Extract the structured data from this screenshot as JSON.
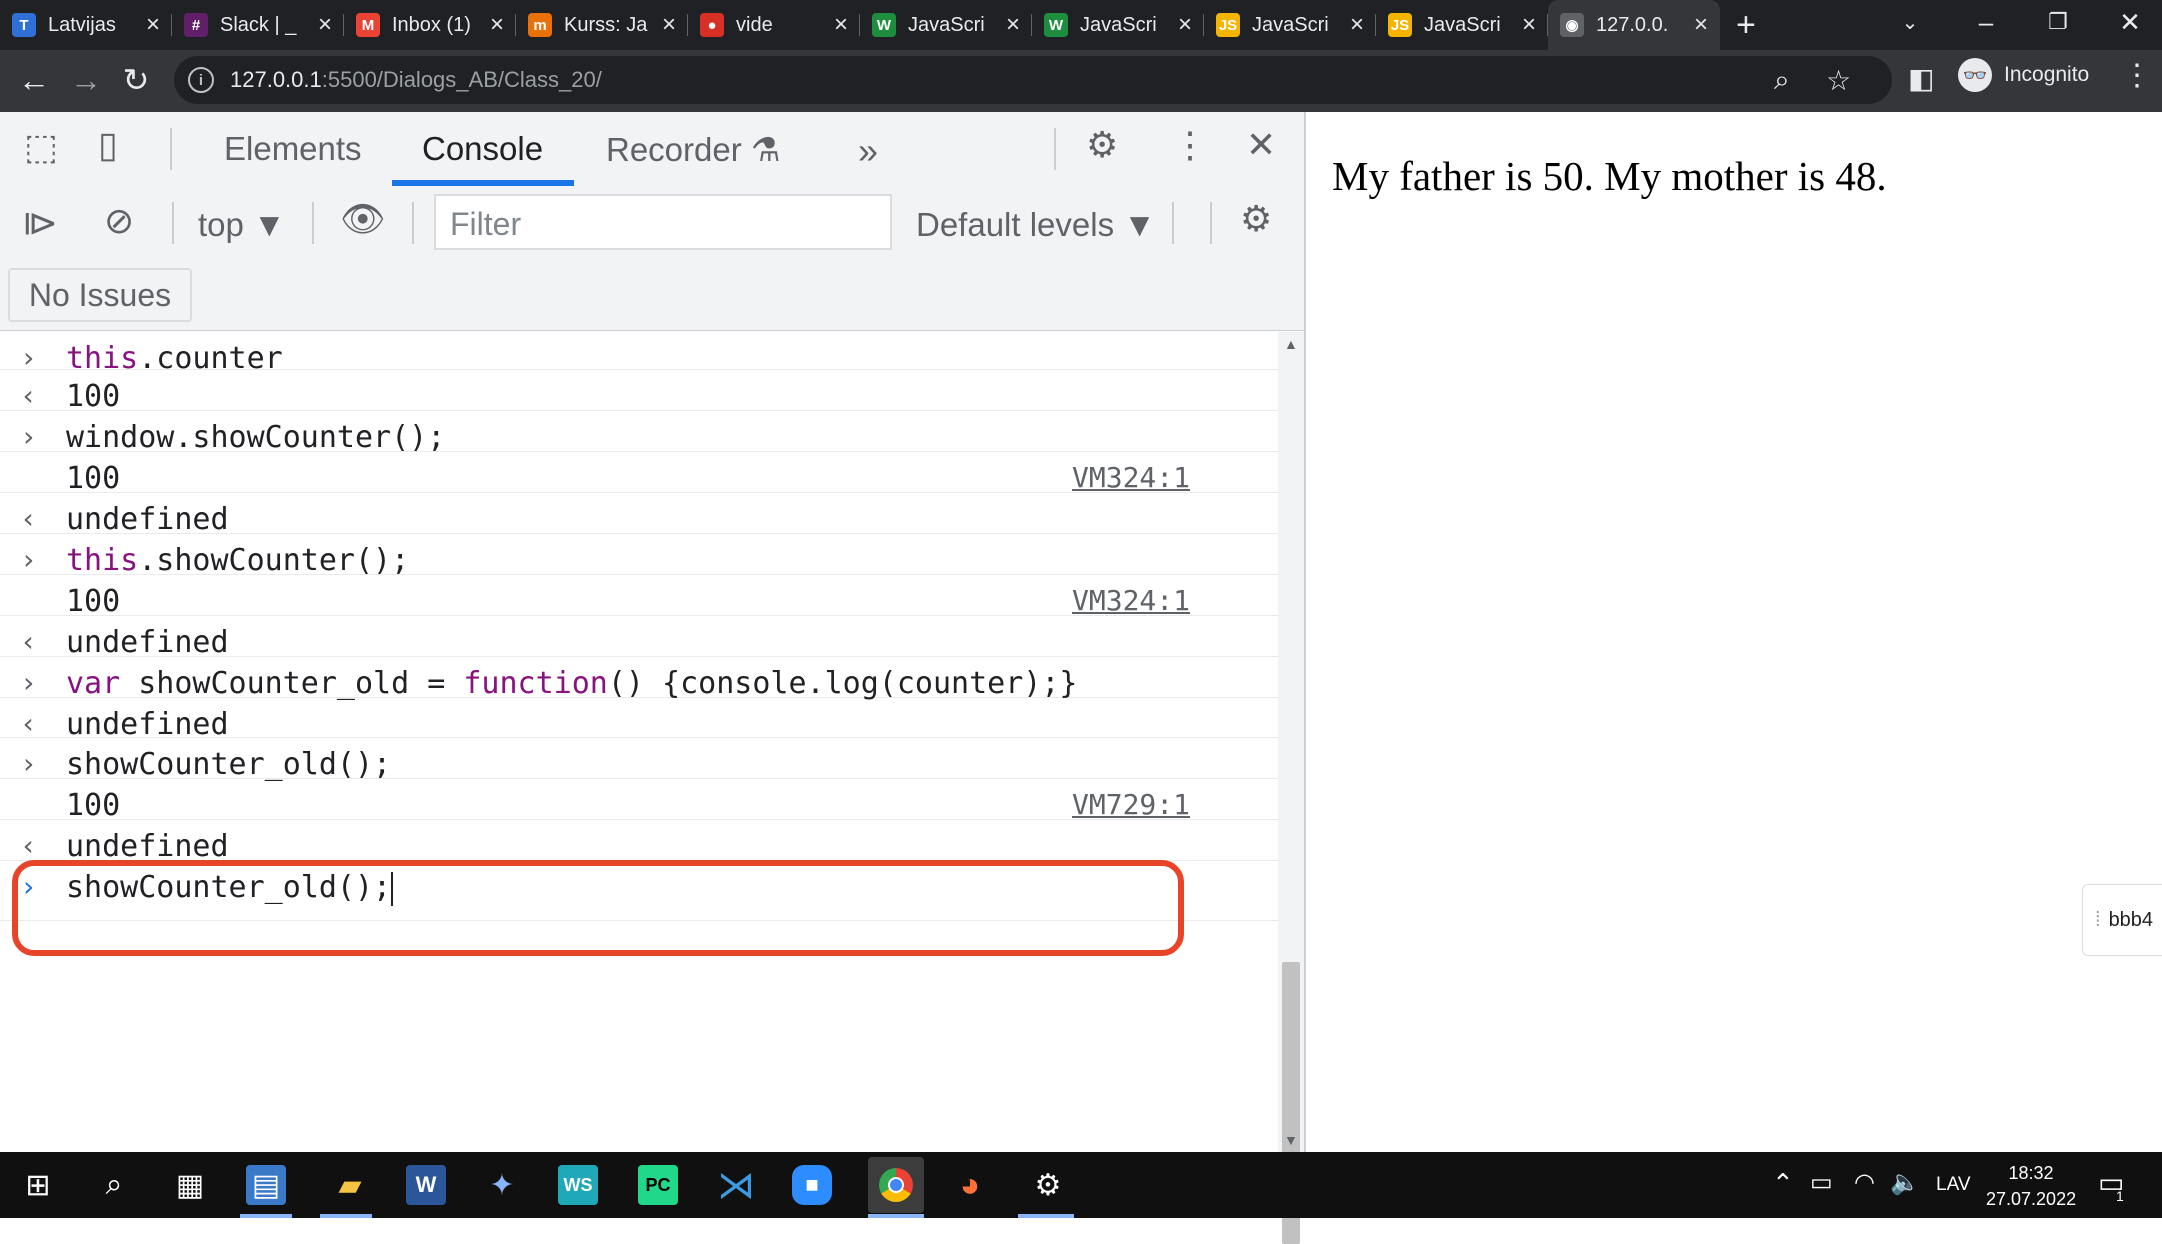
{
  "browser": {
    "tabs": [
      {
        "title": "Latvijas",
        "favicon": "T",
        "favicon_color": "#2f6fd8"
      },
      {
        "title": "Slack | _",
        "favicon": "#",
        "favicon_color": "#611f69"
      },
      {
        "title": "Inbox (1)",
        "favicon": "M",
        "favicon_color": "#ea4335"
      },
      {
        "title": "Kurss: Ja",
        "favicon": "m",
        "favicon_color": "#e8710a"
      },
      {
        "title": "vide",
        "favicon": "●",
        "favicon_color": "#d93025"
      },
      {
        "title": "JavaScri",
        "favicon": "W",
        "favicon_color": "#1e8e3e"
      },
      {
        "title": "JavaScri",
        "favicon": "W",
        "favicon_color": "#1e8e3e"
      },
      {
        "title": "JavaScri",
        "favicon": "JS",
        "favicon_color": "#f4b400"
      },
      {
        "title": "JavaScri",
        "favicon": "JS",
        "favicon_color": "#f4b400"
      },
      {
        "title": "127.0.0.",
        "favicon": "◉",
        "favicon_color": "#5f6368"
      }
    ],
    "url_host": "127.0.0.1",
    "url_path": ":5500/Dialogs_AB/Class_20/",
    "profile_label": "Incognito"
  },
  "devtools": {
    "tabs": [
      "Elements",
      "Console",
      "Recorder"
    ],
    "more": "»",
    "context": "top ▼",
    "filter_placeholder": "Filter",
    "levels": "Default levels ▼",
    "issues": "No Issues",
    "console": [
      {
        "type": "input",
        "code": "this.counter"
      },
      {
        "type": "result",
        "code": "100"
      },
      {
        "type": "input",
        "code": "window.showCounter();"
      },
      {
        "type": "log",
        "code": "100",
        "source": "VM324:1"
      },
      {
        "type": "result",
        "code": "undefined"
      },
      {
        "type": "input",
        "code": "this.showCounter();"
      },
      {
        "type": "log",
        "code": "100",
        "source": "VM324:1"
      },
      {
        "type": "result",
        "code": "undefined"
      },
      {
        "type": "input",
        "code": "var showCounter_old = function() {console.log(counter);}"
      },
      {
        "type": "result",
        "code": "undefined"
      },
      {
        "type": "input",
        "code": "showCounter_old();"
      },
      {
        "type": "log",
        "code": "100",
        "source": "VM729:1"
      },
      {
        "type": "result",
        "code": "undefined"
      },
      {
        "type": "prompt",
        "code": "showCounter_old();"
      }
    ]
  },
  "page": {
    "text": "My father is 50. My mother is 48.",
    "side_widget": "bbb4"
  },
  "taskbar": {
    "language": "LAV",
    "time": "18:32",
    "date": "27.07.2022",
    "notifications": "1"
  },
  "colors": {
    "highlight": "#e8442a",
    "console_number": "#1a1aa6",
    "console_keyword": "#881280",
    "active_tab_underline": "#1a73e8"
  }
}
